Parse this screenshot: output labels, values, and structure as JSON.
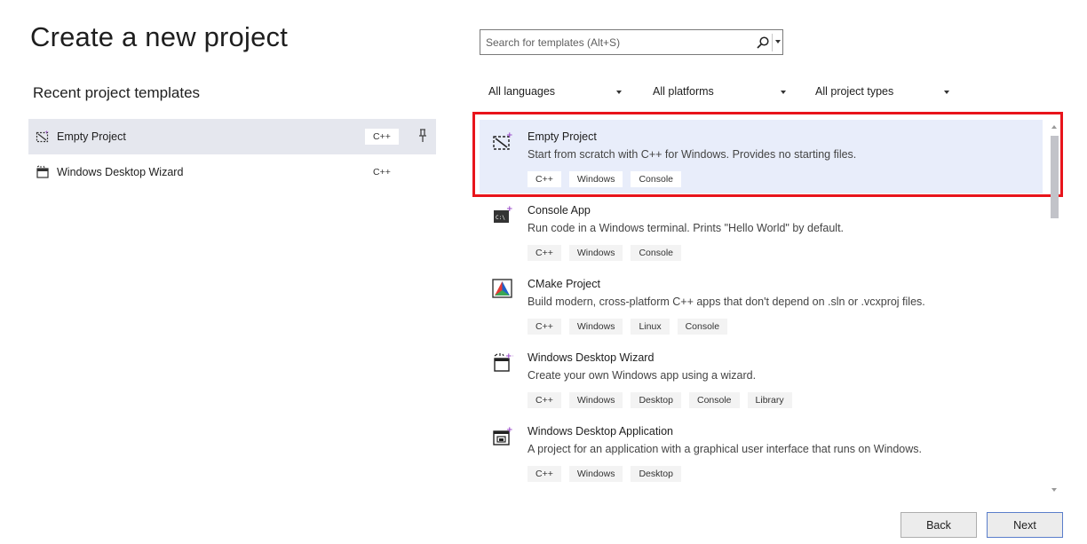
{
  "page_title": "Create a new project",
  "recent": {
    "heading": "Recent project templates",
    "items": [
      {
        "name": "Empty Project",
        "lang": "C++",
        "pinned": true,
        "selected": true
      },
      {
        "name": "Windows Desktop Wizard",
        "lang": "C++",
        "pinned": false,
        "selected": false
      }
    ]
  },
  "search": {
    "placeholder": "Search for templates (Alt+S)",
    "value": ""
  },
  "filters": {
    "language": "All languages",
    "platform": "All platforms",
    "project_type": "All project types"
  },
  "templates": [
    {
      "name": "Empty Project",
      "description": "Start from scratch with C++ for Windows. Provides no starting files.",
      "tags": [
        "C++",
        "Windows",
        "Console"
      ],
      "icon": "empty-project-icon",
      "selected": true
    },
    {
      "name": "Console App",
      "description": "Run code in a Windows terminal. Prints \"Hello World\" by default.",
      "tags": [
        "C++",
        "Windows",
        "Console"
      ],
      "icon": "console-app-icon",
      "selected": false
    },
    {
      "name": "CMake Project",
      "description": "Build modern, cross-platform C++ apps that don't depend on .sln or .vcxproj files.",
      "tags": [
        "C++",
        "Windows",
        "Linux",
        "Console"
      ],
      "icon": "cmake-icon",
      "selected": false
    },
    {
      "name": "Windows Desktop Wizard",
      "description": "Create your own Windows app using a wizard.",
      "tags": [
        "C++",
        "Windows",
        "Desktop",
        "Console",
        "Library"
      ],
      "icon": "desktop-wizard-icon",
      "selected": false
    },
    {
      "name": "Windows Desktop Application",
      "description": "A project for an application with a graphical user interface that runs on Windows.",
      "tags": [
        "C++",
        "Windows",
        "Desktop"
      ],
      "icon": "desktop-application-icon",
      "selected": false
    }
  ],
  "buttons": {
    "back": "Back",
    "next": "Next"
  },
  "colors": {
    "highlight": "#e8141b",
    "selected_bg": "#e8edfa",
    "accent_purple": "#9b4dca"
  }
}
